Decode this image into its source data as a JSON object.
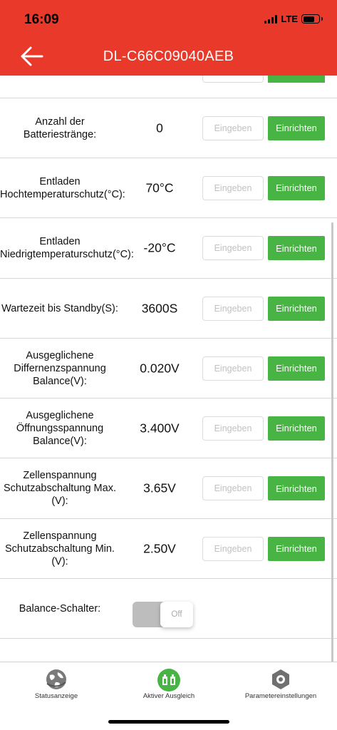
{
  "status_bar": {
    "time": "16:09",
    "network": "LTE"
  },
  "header": {
    "title": "DL-C66C09040AEB"
  },
  "rows": [
    {
      "label": "Anzahl der Batteriestränge:",
      "value": "0",
      "placeholder": "Eingeben",
      "button": "Einrichten"
    },
    {
      "label": "Entladen Hochtemperaturschutz(°C):",
      "value": "70°C",
      "placeholder": "Eingeben",
      "button": "Einrichten"
    },
    {
      "label": "Entladen Niedrigtemperaturschutz(°C):",
      "value": "-20°C",
      "placeholder": "Eingeben",
      "button": "Einrichten"
    },
    {
      "label": "Wartezeit bis Standby(S):",
      "value": "3600S",
      "placeholder": "Eingeben",
      "button": "Einrichten"
    },
    {
      "label": "Ausgeglichene Differnenzspannung Balance(V):",
      "value": "0.020V",
      "placeholder": "Eingeben",
      "button": "Einrichten"
    },
    {
      "label": "Ausgeglichene Öffnungsspannung Balance(V):",
      "value": "3.400V",
      "placeholder": "Eingeben",
      "button": "Einrichten"
    },
    {
      "label": "Zellenspannung Schutzabschaltung Max.(V):",
      "value": "3.65V",
      "placeholder": "Eingeben",
      "button": "Einrichten"
    },
    {
      "label": "Zellenspannung Schutzabschaltung Min.(V):",
      "value": "2.50V",
      "placeholder": "Eingeben",
      "button": "Einrichten"
    }
  ],
  "balance": {
    "label": "Balance-Schalter:",
    "state": "Off"
  },
  "tabs": [
    {
      "label": "Statusanzeige",
      "icon": "globe-icon"
    },
    {
      "label": "Aktiver Ausgleich",
      "icon": "balance-icon"
    },
    {
      "label": "Parametereinstellungen",
      "icon": "settings-icon"
    }
  ],
  "colors": {
    "header": "#e8392a",
    "button": "#48b443",
    "active_tab": "#48b443",
    "inactive_tab": "#707070"
  }
}
